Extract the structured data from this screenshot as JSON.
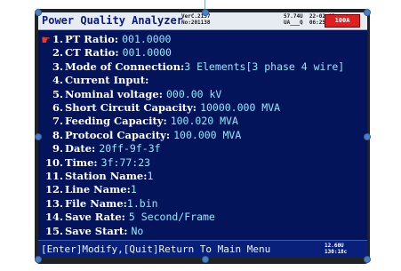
{
  "header": {
    "title": "Power Quality Analyzer",
    "version_line1": "VerC.2157",
    "version_line2": "No:201138",
    "status_line1": "57.74U  22-02-03",
    "status_line2": "UA___Q  06:25:47",
    "badge": "100A"
  },
  "pointer_icon": "hand-pointer-icon",
  "items": [
    {
      "num": "1.",
      "label": "PT Ratio: ",
      "value": "001.0000"
    },
    {
      "num": "2.",
      "label": "CT Ratio: ",
      "value": "001.0000"
    },
    {
      "num": "3.",
      "label": "Mode of Connection:",
      "value": "3 Elements[3 phase 4 wire]"
    },
    {
      "num": "4.",
      "label": "Current Input:",
      "value": ""
    },
    {
      "num": "5.",
      "label": "Nominal voltage: ",
      "value": "000.00 kV"
    },
    {
      "num": "6.",
      "label": "Short Circuit Capacity: ",
      "value": "10000.000 MVA"
    },
    {
      "num": "7.",
      "label": "Feeding Capacity: ",
      "value": "100.020 MVA"
    },
    {
      "num": "8.",
      "label": "Protocol Capacity: ",
      "value": "100.000 MVA"
    },
    {
      "num": "9.",
      "label": "Date: ",
      "value": "20ff-9f-3f"
    },
    {
      "num": "10.",
      "label": "Time: ",
      "value": "3f:77:23"
    },
    {
      "num": "11.",
      "label": "Station Name:",
      "value": "1"
    },
    {
      "num": "12.",
      "label": "Line Name:",
      "value": "1"
    },
    {
      "num": "13.",
      "label": "File Name:",
      "value": "1.bin"
    },
    {
      "num": "14.",
      "label": "Save Rate:  ",
      "value": "5 Second/Frame"
    },
    {
      "num": "15.",
      "label": "Save Start: ",
      "value": "No"
    }
  ],
  "footer": {
    "hint": "[Enter]Modify,[Quit]Return To Main Menu",
    "volt_line1": "12.60U",
    "volt_line2": "130:18c"
  }
}
